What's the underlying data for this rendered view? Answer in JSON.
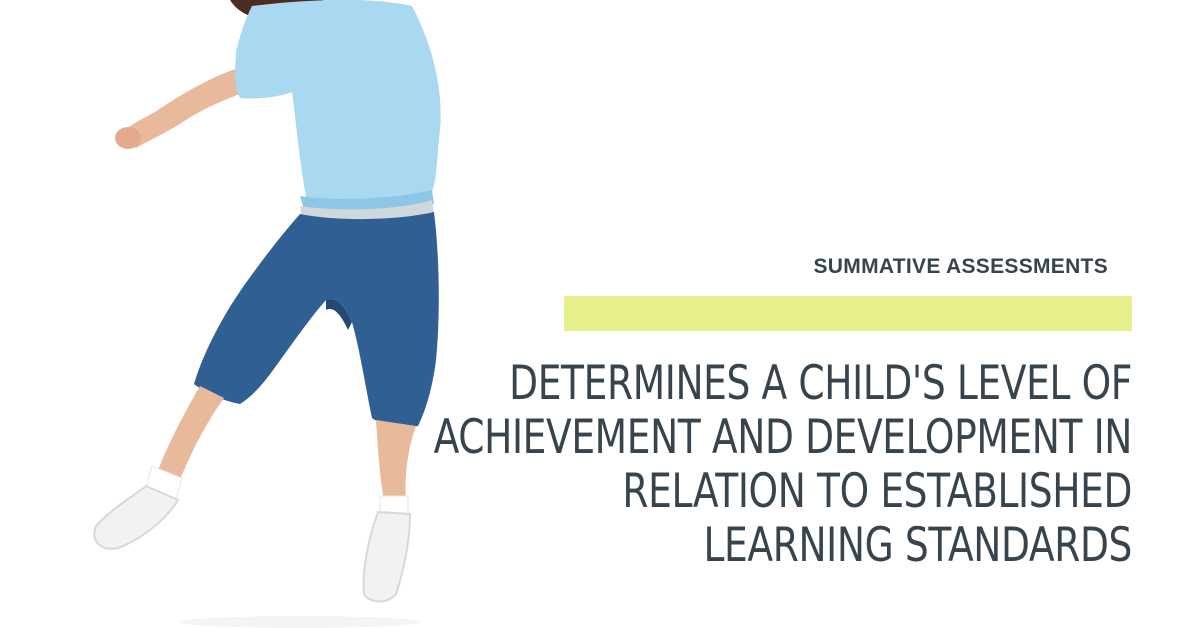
{
  "graphic": {
    "eyebrow": "SUMMATIVE ASSESSMENTS",
    "headline_lines": [
      "DETERMINES A CHILD'S LEVEL OF",
      "ACHIEVEMENT AND DEVELOPMENT IN",
      "RELATION TO ESTABLISHED",
      "LEARNING STANDARDS"
    ],
    "colors": {
      "background": "#ffffff",
      "text": "#37444e",
      "accent_bar": "#e6ef8c",
      "shirt": "#a9d8f1",
      "shorts": "#2f5f93",
      "skin": "#e8b99b",
      "shoes": "#f2f2f2"
    },
    "image": {
      "subject": "child jumping, light blue t-shirt and denim shorts"
    }
  }
}
